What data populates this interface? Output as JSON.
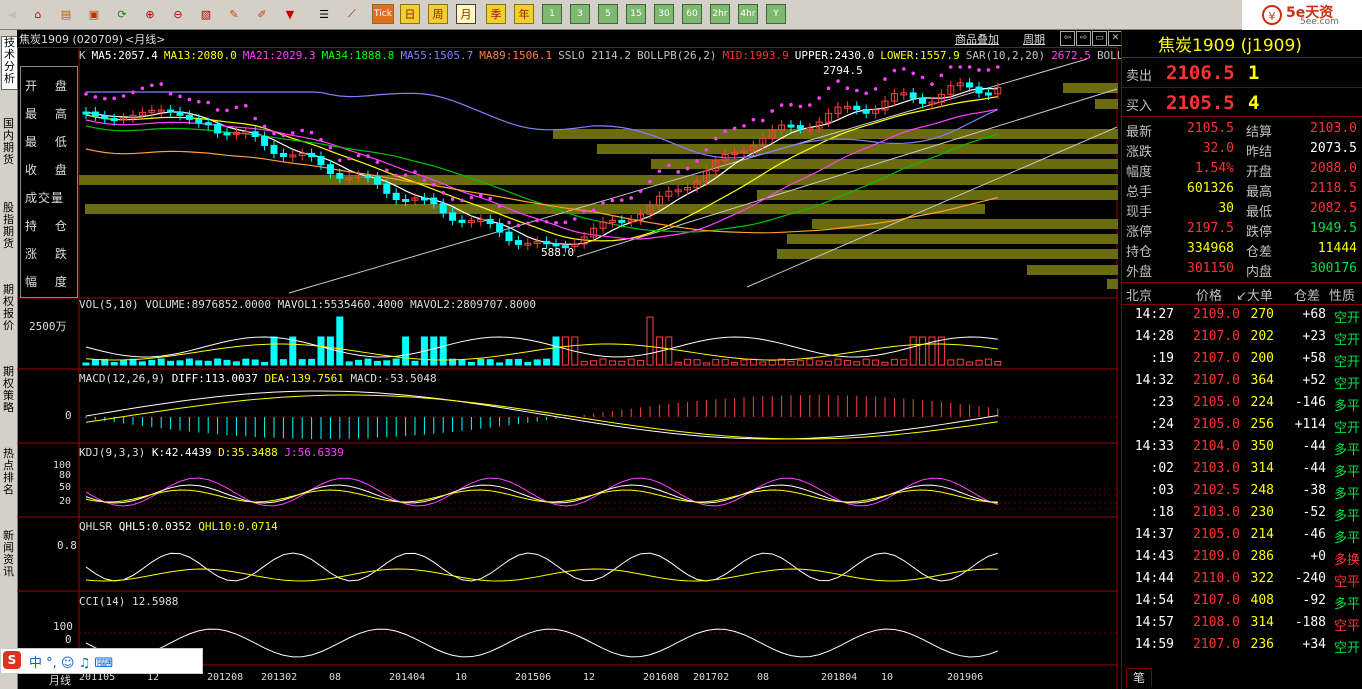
{
  "toolbar": {
    "period_buttons": [
      "Tick",
      "日",
      "周",
      "月",
      "季",
      "年"
    ],
    "minute_buttons": [
      "1",
      "3",
      "5",
      "15",
      "30",
      "60",
      "2hr",
      "4hr",
      "Y"
    ],
    "selected": "月"
  },
  "left_tabs": [
    "技术分析",
    "国内期货",
    "股指期货",
    "期权报价",
    "期权策略",
    "热点排名",
    "新闻资讯"
  ],
  "title": {
    "symbol": "焦炭1909 (020709)",
    "period": "<月线>",
    "overlay_btn": "商品叠加",
    "cycle_btn": "周期"
  },
  "price_chart": {
    "legend": [
      {
        "text": "K",
        "color": "#c0c0c0"
      },
      {
        "text": "MA5:2057.4",
        "color": "#ffffff"
      },
      {
        "text": "MA13:2080.0",
        "color": "#ffff00"
      },
      {
        "text": "MA21:2029.3",
        "color": "#ff40ff"
      },
      {
        "text": "MA34:1888.8",
        "color": "#00ff00"
      },
      {
        "text": "MA55:1505.7",
        "color": "#8080ff"
      },
      {
        "text": "MA89:1506.1",
        "color": "#ff8040"
      },
      {
        "text": "SSLO 2114.2",
        "color": "#c0c0c0"
      },
      {
        "text": "BOLLPB(26,2)",
        "color": "#c0c0c0"
      },
      {
        "text": "MID:1993.9",
        "color": "#ff3030"
      },
      {
        "text": "UPPER:2430.0",
        "color": "#ffffff"
      },
      {
        "text": "LOWER:1557.9",
        "color": "#ffff00"
      },
      {
        "text": "SAR(10,2,20)",
        "color": "#c0c0c0"
      },
      {
        "text": "2672.5",
        "color": "#ff40ff"
      },
      {
        "text": "BOLL",
        "color": "#c0c0c0"
      }
    ],
    "high_label": "2794.5",
    "low_label": "588.0",
    "ohlc_labels": [
      "开  盘",
      "最  高",
      "最  低",
      "收  盘",
      "成交量",
      "持  仓",
      "涨  跌",
      "幅  度"
    ]
  },
  "vol": {
    "legend": "VOL(5,10) VOLUME:8976852.0000 MAVOL1:5535460.4000 MAVOL2:2809707.8000",
    "axis": "2500万"
  },
  "macd": {
    "legend_a": "MACD(12,26,9)",
    "diff": "DIFF:113.0037",
    "dea": "DEA:139.7561",
    "macd": "MACD:-53.5048",
    "axis": "0"
  },
  "kdj": {
    "legend_a": "KDJ(9,3,3)",
    "k": "K:42.4439",
    "d": "D:35.3488",
    "j": "J:56.6339",
    "axis": [
      "100",
      "80",
      "50",
      "20"
    ]
  },
  "qhlsr": {
    "legend_a": "QHLSR",
    "q5": "QHL5:0.0352",
    "q10": "QHL10:0.0714",
    "axis": "0.8"
  },
  "cci": {
    "legend": "CCI(14) 12.5988",
    "axis": [
      "100",
      "0"
    ]
  },
  "xaxis": {
    "label": "月线",
    "ticks": [
      "201105",
      "12",
      "201208",
      "201302",
      "08",
      "201404",
      "10",
      "201506",
      "12",
      "201608",
      "201702",
      "08",
      "201804",
      "10",
      "201906"
    ]
  },
  "quote": {
    "name": "焦炭1909 (j1909)",
    "ask_label": "卖出",
    "ask_price": "2106.5",
    "ask_vol": "1",
    "bid_label": "买入",
    "bid_price": "2105.5",
    "bid_vol": "4",
    "rows": [
      {
        "k1": "最新",
        "v1": "2105.5",
        "c1": "red",
        "k2": "结算",
        "v2": "2103.0",
        "c2": "red"
      },
      {
        "k1": "涨跌",
        "v1": "32.0",
        "c1": "red",
        "k2": "昨结",
        "v2": "2073.5",
        "c2": "white"
      },
      {
        "k1": "幅度",
        "v1": "1.54%",
        "c1": "red",
        "k2": "开盘",
        "v2": "2088.0",
        "c2": "red"
      },
      {
        "k1": "总手",
        "v1": "601326",
        "c1": "yellow",
        "k2": "最高",
        "v2": "2118.5",
        "c2": "red"
      },
      {
        "k1": "现手",
        "v1": "30",
        "c1": "yellow",
        "k2": "最低",
        "v2": "2082.5",
        "c2": "red"
      },
      {
        "k1": "涨停",
        "v1": "2197.5",
        "c1": "red",
        "k2": "跌停",
        "v2": "1949.5",
        "c2": "green"
      },
      {
        "k1": "持仓",
        "v1": "334968",
        "c1": "yellow",
        "k2": "仓差",
        "v2": "11444",
        "c2": "yellow"
      },
      {
        "k1": "外盘",
        "v1": "301150",
        "c1": "red",
        "k2": "内盘",
        "v2": "300176",
        "c2": "green"
      }
    ],
    "tick_headers": [
      "北京",
      "价格",
      "↙大单",
      "仓差",
      "性质"
    ],
    "ticks": [
      {
        "t": "14:27",
        "p": "2109.0",
        "v": "270",
        "d": "+68",
        "n": "空开",
        "nc": "green"
      },
      {
        "t": "14:28",
        "p": "2107.0",
        "v": "202",
        "d": "+23",
        "n": "空开",
        "nc": "green"
      },
      {
        "t": ":19",
        "p": "2107.0",
        "v": "200",
        "d": "+58",
        "n": "空开",
        "nc": "green"
      },
      {
        "t": "14:32",
        "p": "2107.0",
        "v": "364",
        "d": "+52",
        "n": "空开",
        "nc": "green"
      },
      {
        "t": ":23",
        "p": "2105.0",
        "v": "224",
        "d": "-146",
        "n": "多平",
        "nc": "green"
      },
      {
        "t": ":24",
        "p": "2105.0",
        "v": "256",
        "d": "+114",
        "n": "空开",
        "nc": "green"
      },
      {
        "t": "14:33",
        "p": "2104.0",
        "v": "350",
        "d": "-44",
        "n": "多平",
        "nc": "green"
      },
      {
        "t": ":02",
        "p": "2103.0",
        "v": "314",
        "d": "-44",
        "n": "多平",
        "nc": "green"
      },
      {
        "t": ":03",
        "p": "2102.5",
        "v": "248",
        "d": "-38",
        "n": "多平",
        "nc": "green"
      },
      {
        "t": ":18",
        "p": "2103.0",
        "v": "230",
        "d": "-52",
        "n": "多平",
        "nc": "green"
      },
      {
        "t": "14:37",
        "p": "2105.0",
        "v": "214",
        "d": "-46",
        "n": "多平",
        "nc": "green"
      },
      {
        "t": "14:43",
        "p": "2109.0",
        "v": "286",
        "d": "+0",
        "n": "多换",
        "nc": "red"
      },
      {
        "t": "14:44",
        "p": "2110.0",
        "v": "322",
        "d": "-240",
        "n": "空平",
        "nc": "red"
      },
      {
        "t": "14:54",
        "p": "2107.0",
        "v": "408",
        "d": "-92",
        "n": "多平",
        "nc": "green"
      },
      {
        "t": "14:57",
        "p": "2108.0",
        "v": "314",
        "d": "-188",
        "n": "空平",
        "nc": "red"
      },
      {
        "t": "14:59",
        "p": "2107.0",
        "v": "236",
        "d": "+34",
        "n": "空开",
        "nc": "green"
      }
    ],
    "bottom_tab": "笔"
  },
  "brand": {
    "name": "5e天资",
    "site": "5ee.com"
  },
  "ime": {
    "text": "中 °, ☺ ♫ ⌨"
  }
}
